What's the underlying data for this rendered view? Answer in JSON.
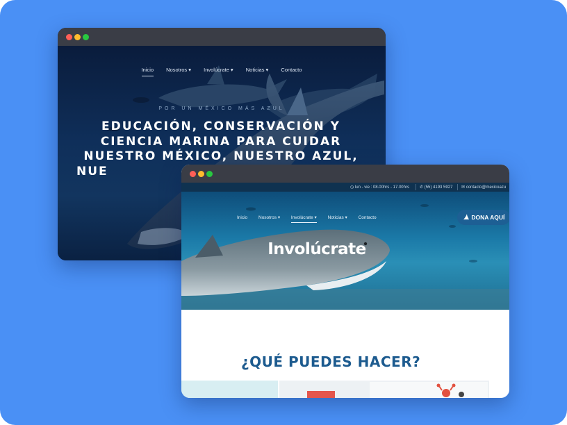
{
  "colors": {
    "background": "#4a90f5",
    "window_chrome": "#3a3d46",
    "traffic_close": "#ff5f57",
    "traffic_minimize": "#febc2e",
    "traffic_zoom": "#28c840",
    "heading_blue": "#1d5b8f",
    "donate_button": "#1d5f94"
  },
  "window1": {
    "nav": {
      "items": [
        {
          "label": "Inicio",
          "active": true,
          "dropdown": false
        },
        {
          "label": "Nosotros",
          "dropdown": true
        },
        {
          "label": "Involúcrate",
          "dropdown": true
        },
        {
          "label": "Noticias",
          "dropdown": true
        },
        {
          "label": "Contacto",
          "dropdown": false
        }
      ]
    },
    "tagline": "POR UN MÉXICO MÁS AZUL",
    "headline_lines": [
      "EDUCACIÓN, CONSERVACIÓN Y",
      "CIENCIA MARINA PARA CUIDAR",
      "NUESTRO MÉXICO, NUESTRO AZUL,",
      "NUE"
    ]
  },
  "window2": {
    "topbar": {
      "hours": "lun - vie : 08.00hrs - 17.00hrs",
      "phone": "(55) 4193 5927",
      "email": "contacto@mexicoazu",
      "hours_icon": "clock-icon",
      "phone_icon": "phone-icon",
      "email_icon": "mail-icon"
    },
    "nav": {
      "items": [
        {
          "label": "Inicio",
          "dropdown": false
        },
        {
          "label": "Nosotros",
          "dropdown": true
        },
        {
          "label": "Involúcrate",
          "active": true,
          "dropdown": true
        },
        {
          "label": "Noticias",
          "dropdown": true
        },
        {
          "label": "Contacto",
          "dropdown": false
        }
      ]
    },
    "donate_label": "DONA AQUÍ",
    "donate_icon": "shark-fin-icon",
    "hero_title": "Involúcrate",
    "section_heading": "¿QUÉ PUEDES HACER?"
  }
}
